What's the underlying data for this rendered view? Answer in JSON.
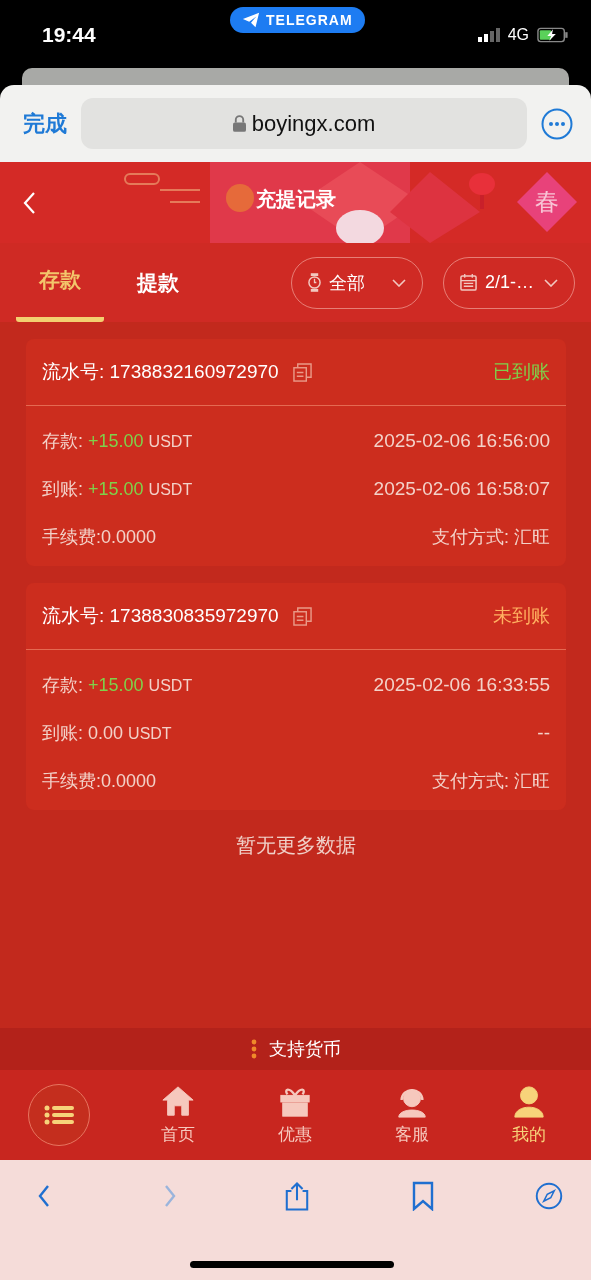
{
  "status_bar": {
    "time": "19:44",
    "app_pill": "TELEGRAM",
    "network": "4G"
  },
  "browser": {
    "done": "完成",
    "url": "boyingx.com"
  },
  "header": {
    "title": "充提记录",
    "badge": "春"
  },
  "tabs": [
    {
      "label": "存款",
      "selected": true
    },
    {
      "label": "提款",
      "selected": false
    }
  ],
  "filters": [
    {
      "kind": "status",
      "label": "全部"
    },
    {
      "kind": "date",
      "label": "2/1-…"
    }
  ],
  "records": [
    {
      "serial_label": "流水号:",
      "serial": "1738832160972970",
      "status": "已到账",
      "credited": true,
      "deposit_label": "存款:",
      "deposit_amount": "+15.00",
      "deposit_unit": "USDT",
      "deposit_time": "2025-02-06 16:56:00",
      "arrival_label": "到账:",
      "arrival_amount": "+15.00",
      "arrival_unit": "USDT",
      "arrival_time": "2025-02-06 16:58:07",
      "fee": "手续费:0.0000",
      "payment": "支付方式: 汇旺"
    },
    {
      "serial_label": "流水号:",
      "serial": "1738830835972970",
      "status": "未到账",
      "credited": false,
      "deposit_label": "存款:",
      "deposit_amount": "+15.00",
      "deposit_unit": "USDT",
      "deposit_time": "2025-02-06 16:33:55",
      "arrival_label": "到账:",
      "arrival_amount": "0.00",
      "arrival_unit": "USDT",
      "arrival_time": "--",
      "fee": "手续费:0.0000",
      "payment": "支付方式: 汇旺"
    }
  ],
  "end_note": "暂无更多数据",
  "support_label": "支持货币",
  "nav": [
    {
      "kind": "menu",
      "selected": false
    },
    {
      "kind": "home",
      "label": "首页",
      "selected": false
    },
    {
      "kind": "gift",
      "label": "优惠",
      "selected": false
    },
    {
      "kind": "support",
      "label": "客服",
      "selected": false
    },
    {
      "kind": "profile",
      "label": "我的",
      "selected": true
    }
  ],
  "toolbar": [
    {
      "kind": "back",
      "disabled": false
    },
    {
      "kind": "forward",
      "disabled": true
    },
    {
      "kind": "share",
      "disabled": false
    },
    {
      "kind": "bookmarks",
      "disabled": false
    },
    {
      "kind": "compass",
      "disabled": false
    }
  ]
}
